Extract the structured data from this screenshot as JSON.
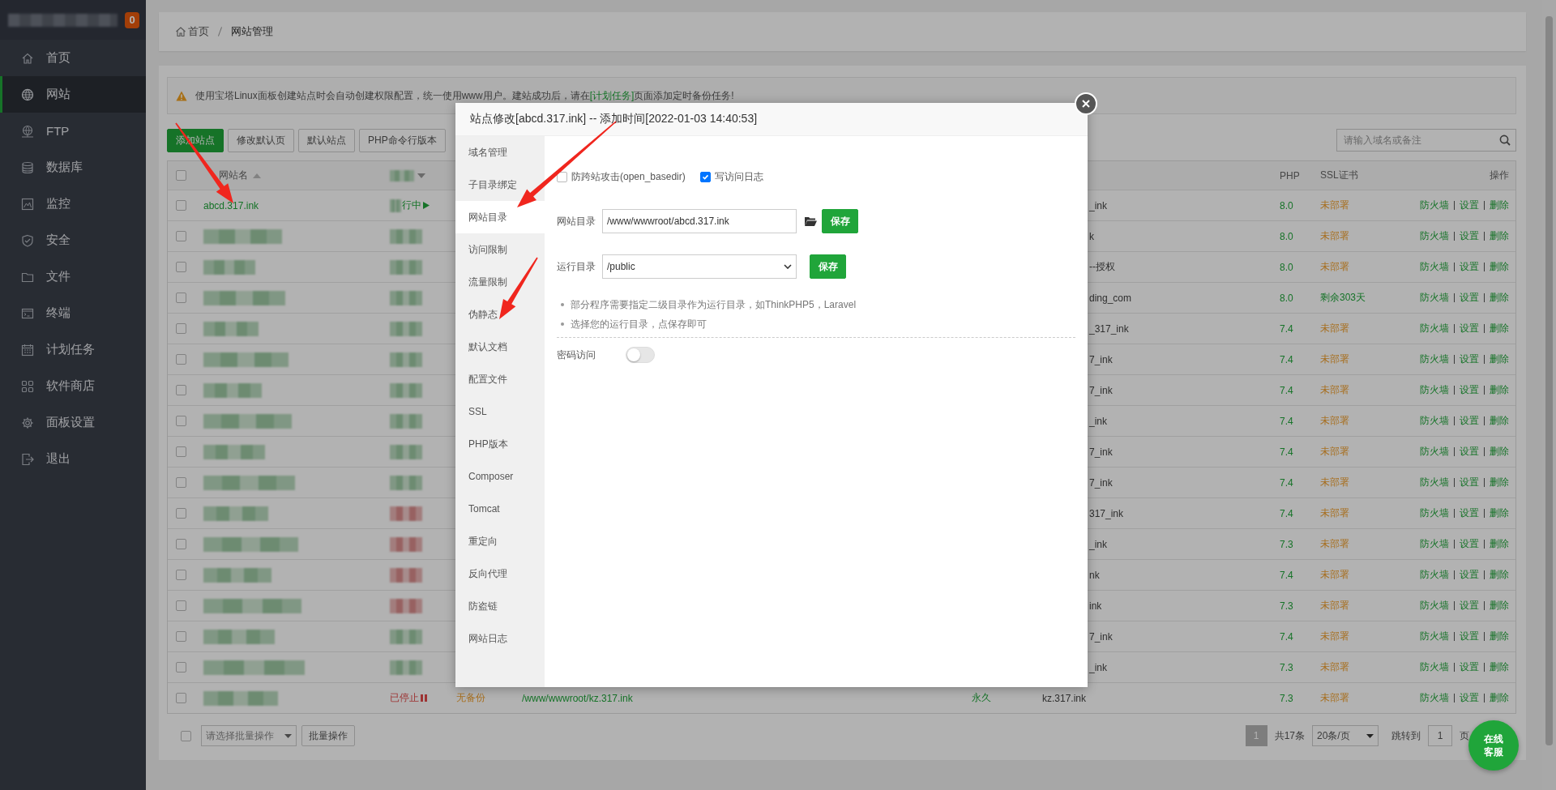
{
  "sidebar": {
    "badge": "0",
    "items": [
      {
        "label": "首页",
        "selected": false
      },
      {
        "label": "网站",
        "selected": true
      },
      {
        "label": "FTP",
        "selected": false
      },
      {
        "label": "数据库",
        "selected": false
      },
      {
        "label": "监控",
        "selected": false
      },
      {
        "label": "安全",
        "selected": false
      },
      {
        "label": "文件",
        "selected": false
      },
      {
        "label": "终端",
        "selected": false
      },
      {
        "label": "计划任务",
        "selected": false
      },
      {
        "label": "软件商店",
        "selected": false
      },
      {
        "label": "面板设置",
        "selected": false
      },
      {
        "label": "退出",
        "selected": false
      }
    ]
  },
  "breadcrumb": [
    "首页",
    "网站管理"
  ],
  "notice": {
    "before": "使用宝塔Linux面板创建站点时会自动创建权限配置，统一使用www用户。建站成功后，请在",
    "link": "[计划任务]",
    "after": "页面添加定时备份任务!"
  },
  "toolbar": {
    "buttons": [
      {
        "label": "添加站点",
        "primary": true
      },
      {
        "label": "修改默认页",
        "primary": false
      },
      {
        "label": "默认站点",
        "primary": false
      },
      {
        "label": "PHP命令行版本",
        "primary": false
      }
    ],
    "search": {
      "placeholder": "请输入域名或备注"
    }
  },
  "table": {
    "select_all_checked": false,
    "columns": {
      "name": "网站名",
      "php": "PHP",
      "ssl": "SSL证书",
      "actions": "操作"
    },
    "rows": [
      {
        "checked": false,
        "name": "abcd.317.ink",
        "stopped": false,
        "status": "行中",
        "remark": "_ink",
        "php": "8.0",
        "ssl": "未部署",
        "ssl_deployed": false,
        "actions": [
          "防火墙",
          "设置",
          "删除"
        ]
      },
      {
        "checked": false,
        "stopped": false,
        "remark": "k",
        "php": "8.0",
        "ssl": "未部署",
        "ssl_deployed": false,
        "actions": [
          "防火墙",
          "设置",
          "删除"
        ]
      },
      {
        "checked": false,
        "stopped": false,
        "remark": "--授权",
        "php": "8.0",
        "ssl": "未部署",
        "ssl_deployed": false,
        "actions": [
          "防火墙",
          "设置",
          "删除"
        ]
      },
      {
        "checked": false,
        "stopped": false,
        "remark": "ding_com",
        "php": "8.0",
        "ssl": "剩余303天",
        "ssl_deployed": true,
        "actions": [
          "防火墙",
          "设置",
          "删除"
        ]
      },
      {
        "checked": false,
        "stopped": false,
        "remark": "_317_ink",
        "php": "7.4",
        "ssl": "未部署",
        "ssl_deployed": false,
        "actions": [
          "防火墙",
          "设置",
          "删除"
        ]
      },
      {
        "checked": false,
        "stopped": false,
        "remark": "7_ink",
        "php": "7.4",
        "ssl": "未部署",
        "ssl_deployed": false,
        "actions": [
          "防火墙",
          "设置",
          "删除"
        ]
      },
      {
        "checked": false,
        "stopped": false,
        "remark": "7_ink",
        "php": "7.4",
        "ssl": "未部署",
        "ssl_deployed": false,
        "actions": [
          "防火墙",
          "设置",
          "删除"
        ]
      },
      {
        "checked": false,
        "stopped": false,
        "remark": "_ink",
        "php": "7.4",
        "ssl": "未部署",
        "ssl_deployed": false,
        "actions": [
          "防火墙",
          "设置",
          "删除"
        ]
      },
      {
        "checked": false,
        "stopped": false,
        "remark": "7_ink",
        "php": "7.4",
        "ssl": "未部署",
        "ssl_deployed": false,
        "actions": [
          "防火墙",
          "设置",
          "删除"
        ]
      },
      {
        "checked": false,
        "stopped": false,
        "remark": "7_ink",
        "php": "7.4",
        "ssl": "未部署",
        "ssl_deployed": false,
        "actions": [
          "防火墙",
          "设置",
          "删除"
        ]
      },
      {
        "checked": false,
        "stopped": true,
        "remark": "317_ink",
        "php": "7.4",
        "ssl": "未部署",
        "ssl_deployed": false,
        "actions": [
          "防火墙",
          "设置",
          "删除"
        ]
      },
      {
        "checked": false,
        "stopped": true,
        "remark": "_ink",
        "php": "7.3",
        "ssl": "未部署",
        "ssl_deployed": false,
        "actions": [
          "防火墙",
          "设置",
          "删除"
        ]
      },
      {
        "checked": false,
        "stopped": true,
        "remark": "nk",
        "php": "7.4",
        "ssl": "未部署",
        "ssl_deployed": false,
        "actions": [
          "防火墙",
          "设置",
          "删除"
        ]
      },
      {
        "checked": false,
        "stopped": true,
        "remark": "ink",
        "php": "7.3",
        "ssl": "未部署",
        "ssl_deployed": false,
        "actions": [
          "防火墙",
          "设置",
          "删除"
        ]
      },
      {
        "checked": false,
        "stopped": false,
        "remark": "7_ink",
        "php": "7.4",
        "ssl": "未部署",
        "ssl_deployed": false,
        "actions": [
          "防火墙",
          "设置",
          "删除"
        ]
      },
      {
        "checked": false,
        "stopped": false,
        "remark": "_ink",
        "php": "7.3",
        "ssl": "未部署",
        "ssl_deployed": false,
        "actions": [
          "防火墙",
          "设置",
          "删除"
        ]
      },
      {
        "checked": false,
        "stopped": true,
        "status": "已停止",
        "backup": "无备份",
        "path": "/www/wwwroot/kz.317.ink",
        "expiry": "永久",
        "remark": "kz.317.ink",
        "php": "7.3",
        "ssl": "未部署",
        "ssl_deployed": false,
        "actions": [
          "防火墙",
          "设置",
          "删除"
        ]
      }
    ]
  },
  "footer": {
    "checked": false,
    "batch_placeholder": "请选择批量操作",
    "batch_button": "批量操作",
    "pages": [
      {
        "label": "1",
        "selected": true
      }
    ],
    "total": "共17条",
    "page_size": "20条/页",
    "jump_label": "跳转到",
    "jump_value": "1",
    "page_unit": "页"
  },
  "chat_button": [
    "在线",
    "客服"
  ],
  "modal": {
    "title": "站点修改[abcd.317.ink] -- 添加时间[2022-01-03 14:40:53]",
    "tabs": [
      {
        "label": "域名管理",
        "selected": false
      },
      {
        "label": "子目录绑定",
        "selected": false
      },
      {
        "label": "网站目录",
        "selected": true
      },
      {
        "label": "访问限制",
        "selected": false
      },
      {
        "label": "流量限制",
        "selected": false
      },
      {
        "label": "伪静态",
        "selected": false
      },
      {
        "label": "默认文档",
        "selected": false
      },
      {
        "label": "配置文件",
        "selected": false
      },
      {
        "label": "SSL",
        "selected": false
      },
      {
        "label": "PHP版本",
        "selected": false
      },
      {
        "label": "Composer",
        "selected": false
      },
      {
        "label": "Tomcat",
        "selected": false
      },
      {
        "label": "重定向",
        "selected": false
      },
      {
        "label": "反向代理",
        "selected": false
      },
      {
        "label": "防盗链",
        "selected": false
      },
      {
        "label": "网站日志",
        "selected": false
      }
    ],
    "options": [
      {
        "label": "防跨站攻击(open_basedir)",
        "checked": false
      },
      {
        "label": "写访问日志",
        "checked": true
      }
    ],
    "site_dir": {
      "label": "网站目录",
      "value": "/www/wwwroot/abcd.317.ink",
      "button": "保存"
    },
    "run_dir": {
      "label": "运行目录",
      "value": "/public",
      "button": "保存"
    },
    "tips": [
      "部分程序需要指定二级目录作为运行目录，如ThinkPHP5，Laravel",
      "选择您的运行目录，点保存即可"
    ],
    "password_access": {
      "label": "密码访问",
      "on": false
    }
  }
}
